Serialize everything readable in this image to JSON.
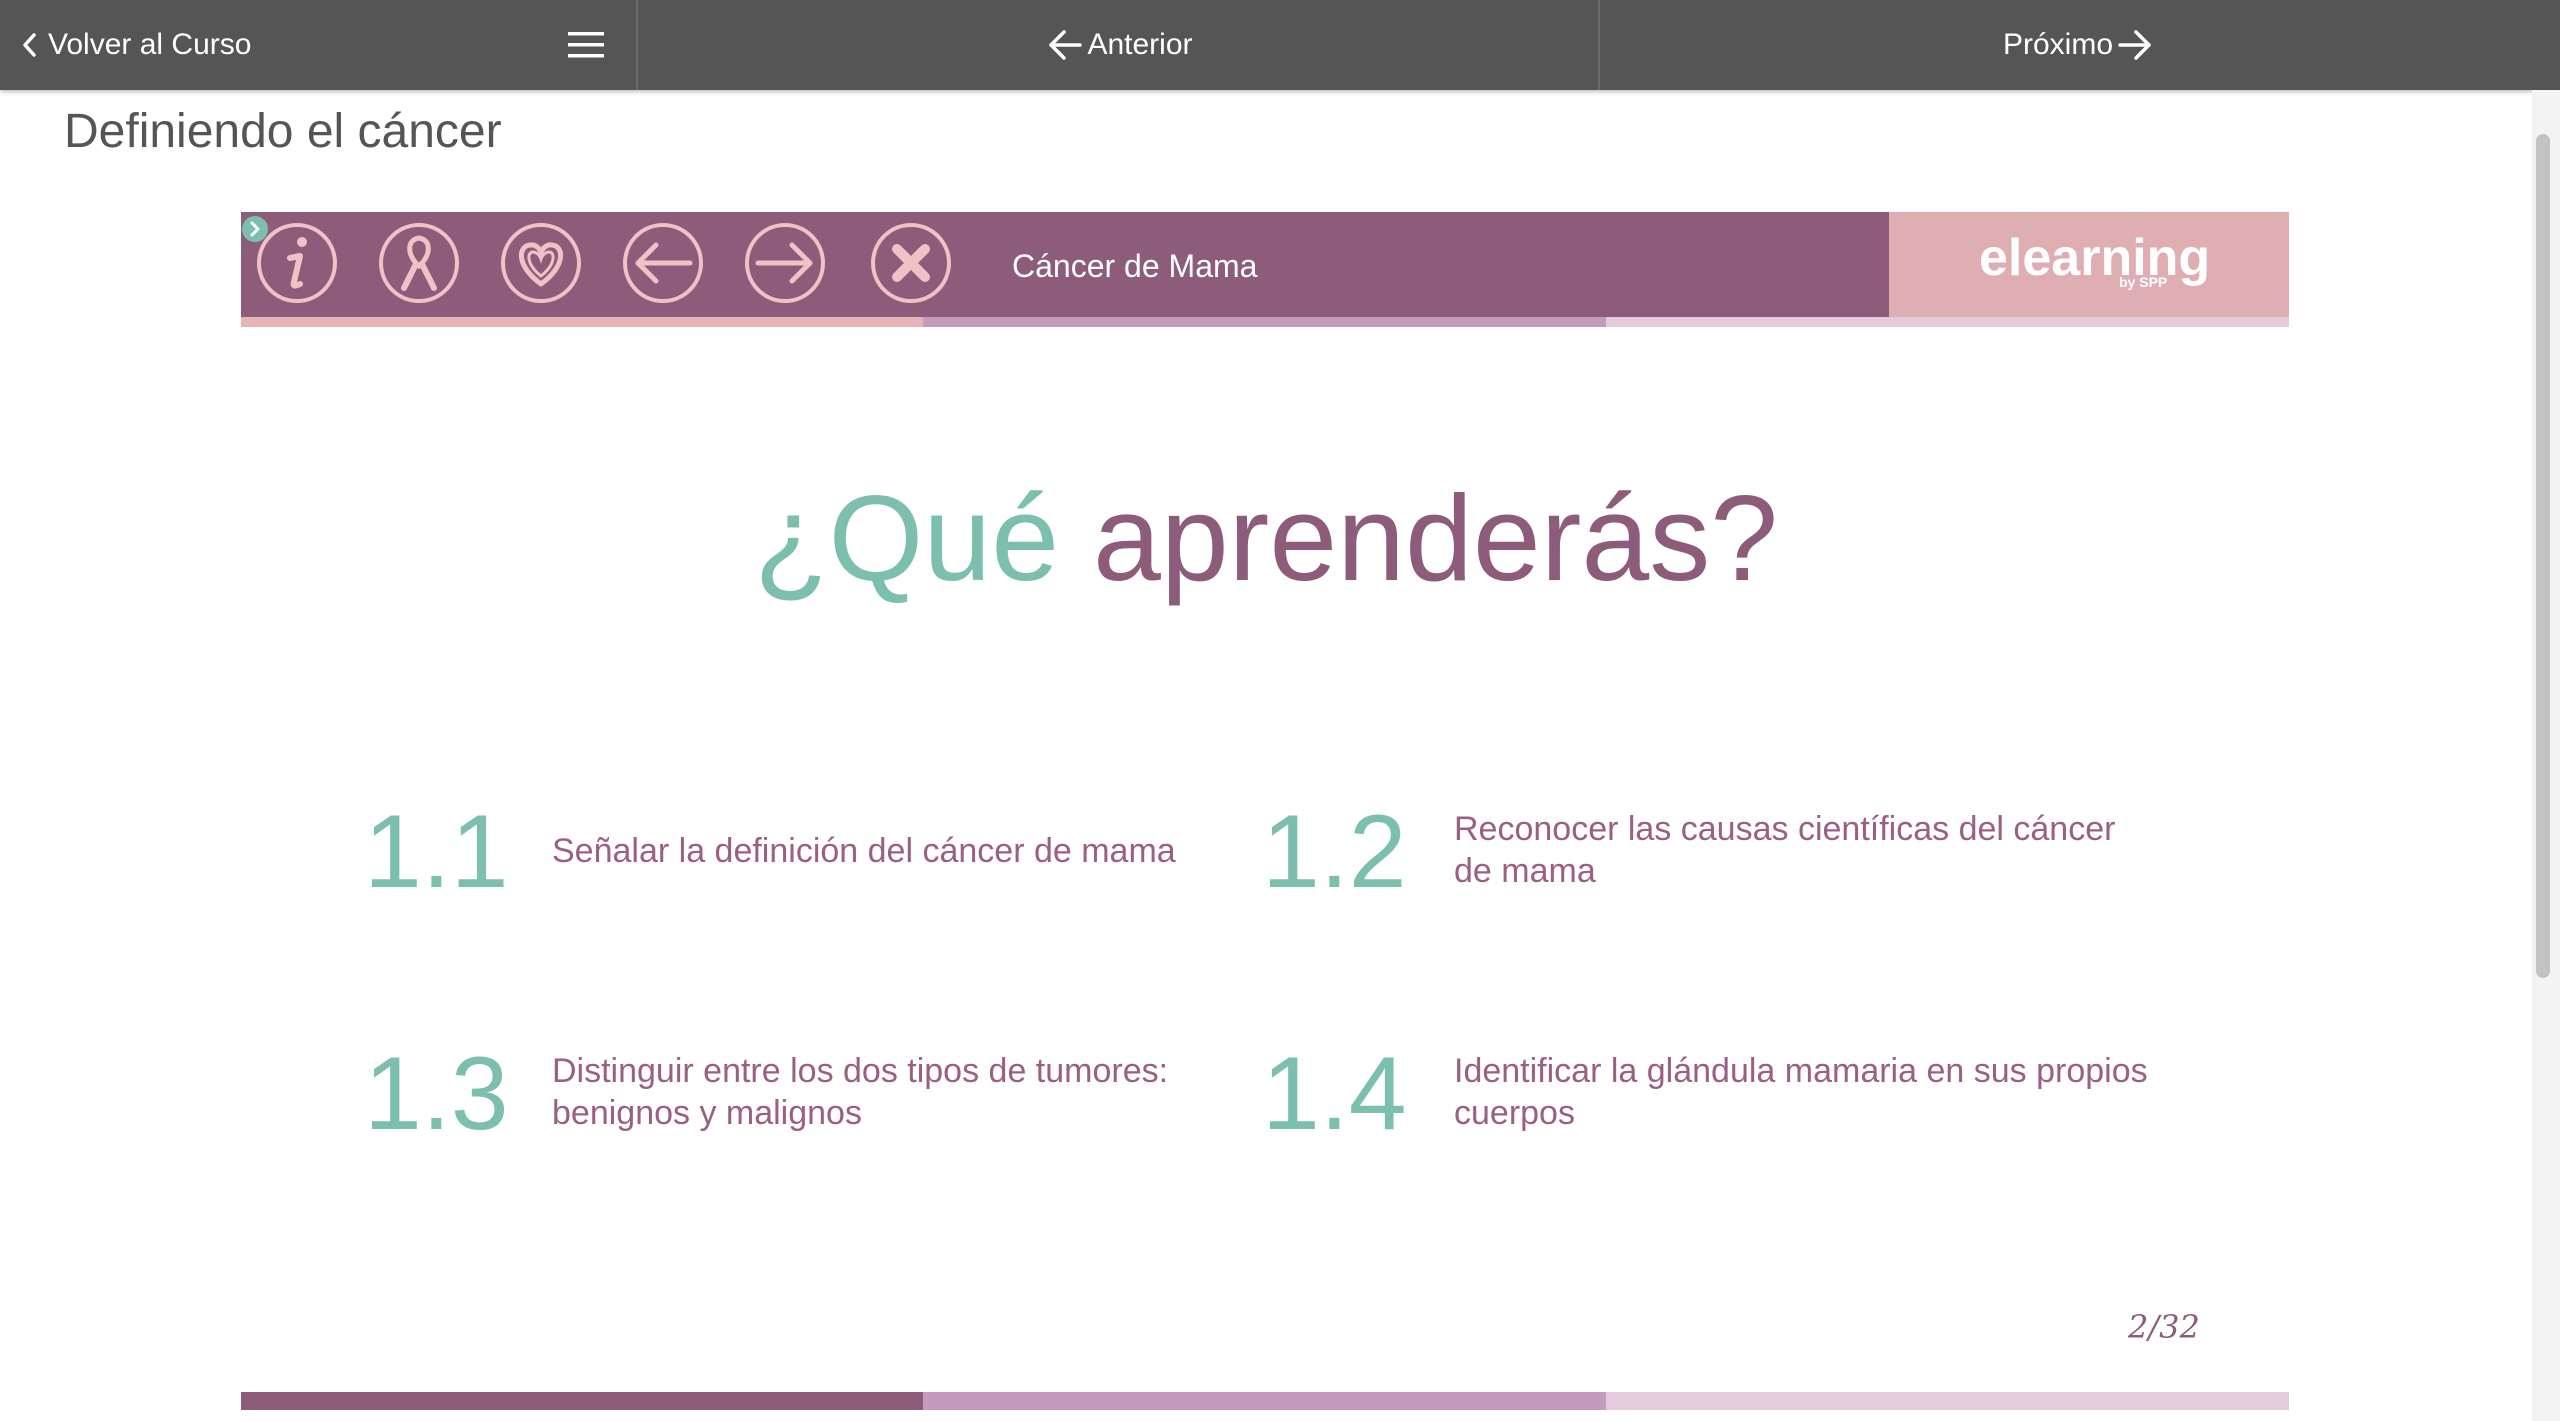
{
  "topbar": {
    "back_label": "Volver al Curso",
    "prev_label": "Anterior",
    "next_label": "Próximo"
  },
  "page_title": "Definiendo el cáncer",
  "slide": {
    "header_title": "Cáncer de Mama",
    "logo_text": "elearning",
    "logo_sub": "by SPP",
    "header_icons": [
      "info-icon",
      "ribbon-icon",
      "heart-icon",
      "arrow-left-icon",
      "arrow-right-icon",
      "close-icon"
    ],
    "headline_part1": "¿Qué",
    "headline_part2": "aprenderás?",
    "objectives": [
      {
        "num": "1.1",
        "text": "Señalar la definición del cáncer de mama"
      },
      {
        "num": "1.2",
        "text": "Reconocer las causas científicas del cáncer de mama"
      },
      {
        "num": "1.3",
        "text": "Distinguir entre los dos tipos de tumores: benignos y malignos"
      },
      {
        "num": "1.4",
        "text": "Identificar la glándula mamaria en sus propios cuerpos"
      }
    ],
    "page_counter": "2/32"
  },
  "colors": {
    "topbar": "#555555",
    "header": "#8c5c7a",
    "logo_panel": "#dfaeb3",
    "teal": "#7dbfae",
    "purple": "#8c5c7a",
    "stripe_light": "#e4cbdc",
    "stripe_mid": "#c39bbc",
    "stripe_pink": "#e6b3b6"
  }
}
